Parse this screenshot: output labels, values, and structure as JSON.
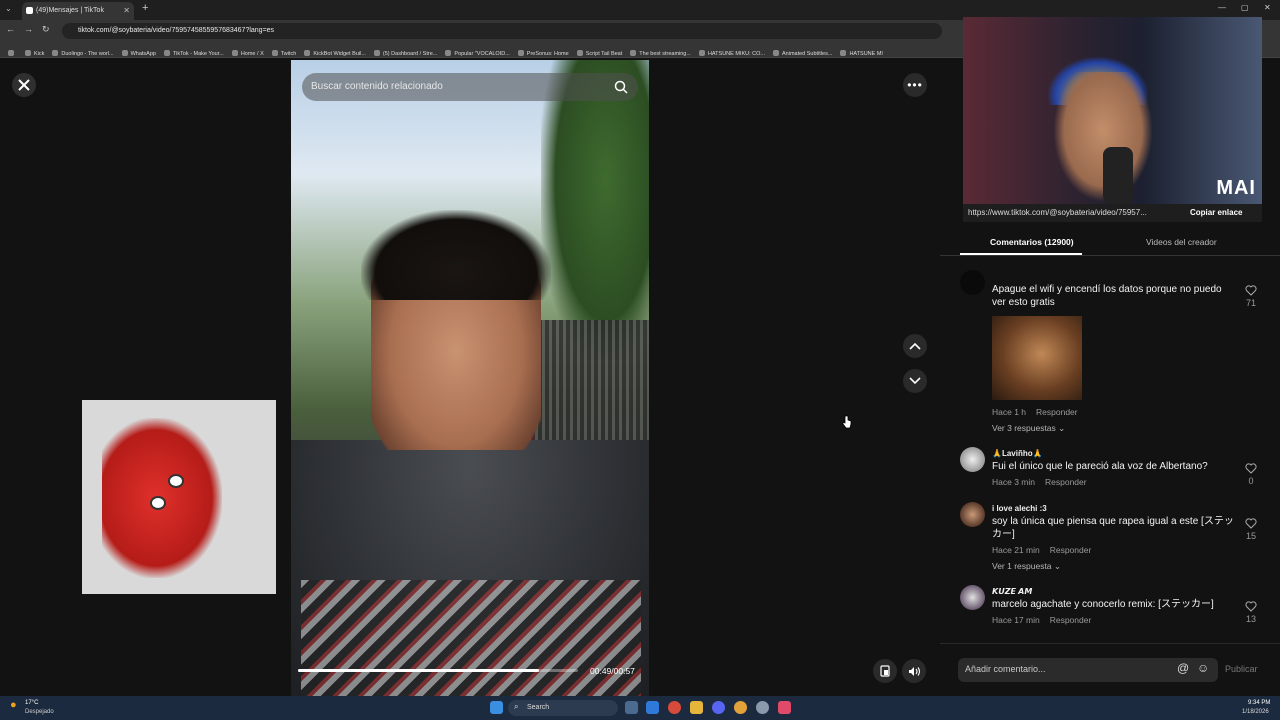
{
  "browser": {
    "tab_title": "(49)Mensajes | TikTok",
    "url": "tiktok.com/@soybateria/video/7595745855957683467?lang=es",
    "bookmarks": [
      "Kick",
      "Duolingo - The worl...",
      "WhatsApp",
      "TikTok - Make Your...",
      "Home / X",
      "Twitch",
      "KickBot Widget Buil...",
      "(5) Dashboard / Stre...",
      "Popular \"VOCALOID...",
      "PreSonus: Home",
      "Script Tail Beat",
      "The best streaming...",
      "HATSUNE MIKU: CO...",
      "Animated Subtitles...",
      "HATSUNE MI"
    ]
  },
  "video": {
    "search_placeholder": "Buscar contenido relacionado",
    "time": "00:49/00:57",
    "progress": 0.86
  },
  "streamer_overlay": {
    "logo": "MAI",
    "link": "https://www.tiktok.com/@soybateria/video/75957...",
    "copy_label": "Copiar enlace"
  },
  "tabs": {
    "comments": "Comentarios (12900)",
    "creator_videos": "Videos del creador"
  },
  "comments": [
    {
      "text": "Apague el wifi y encendí los datos porque no puedo ver esto gratis",
      "time": "Hace 1 h",
      "reply": "Responder",
      "likes": "71",
      "replies": "Ver 3 respuestas"
    },
    {
      "name": "🙏Laviñho🙏",
      "text": "Fui el único que le pareció ala voz de Albertano?",
      "time": "Hace 3 min",
      "reply": "Responder",
      "likes": "0"
    },
    {
      "name": "i love alechi :3",
      "text": "soy la única que piensa que rapea igual a este [ステッカー]",
      "time": "Hace 21 min",
      "reply": "Responder",
      "likes": "15",
      "replies": "Ver 1 respuesta"
    },
    {
      "name": "𝙆𝙐𝙕𝙀 𝘼𝙈",
      "text": "marcelo agachate y conocerlo remix: [ステッカー]",
      "time": "Hace 17 min",
      "reply": "Responder",
      "likes": "13"
    }
  ],
  "composer": {
    "placeholder": "Añadir comentario...",
    "publish": "Publicar"
  },
  "taskbar": {
    "weather_temp": "17°C",
    "weather_desc": "Despejado",
    "search": "Search",
    "time": "9:34 PM",
    "date": "1/18/2026"
  },
  "colors": {
    "background": "#121212",
    "taskbar": "#1b2a3e",
    "accent_white": "#ffffff"
  }
}
